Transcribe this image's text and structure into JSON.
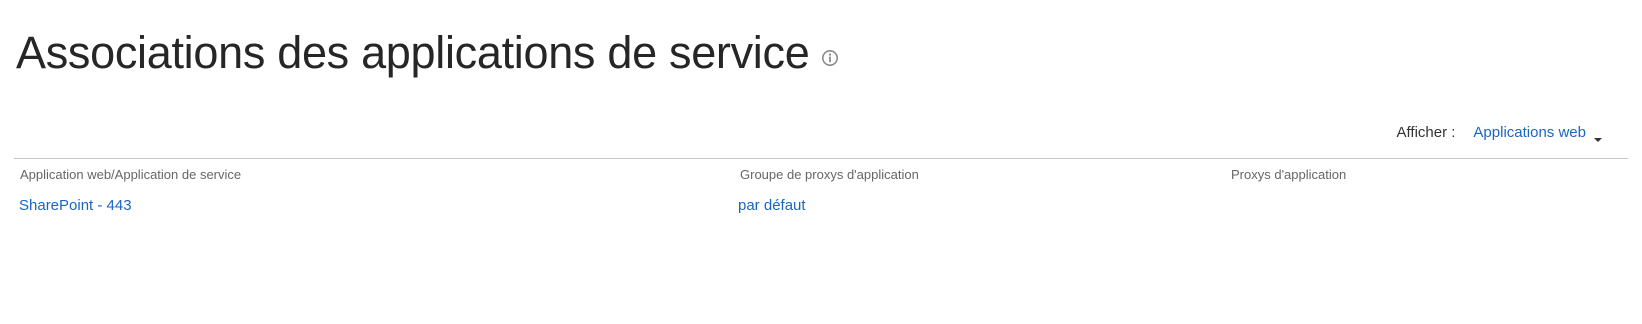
{
  "page": {
    "title": "Associations des applications de service"
  },
  "icons": {
    "info": "info-circle-icon",
    "caret": "caret-down-icon"
  },
  "view": {
    "label": "Afficher :",
    "selected": "Applications web"
  },
  "table": {
    "columns": [
      "Application web/Application de service",
      "Groupe de proxys d'application",
      "Proxys d'application"
    ],
    "rows": [
      {
        "web_application": "SharePoint - 443",
        "proxy_group": "par défaut",
        "proxies": ""
      }
    ]
  },
  "colors": {
    "link": "#1a66c2",
    "title": "#262626",
    "header_text": "#666666",
    "divider": "#c6c6c6"
  }
}
